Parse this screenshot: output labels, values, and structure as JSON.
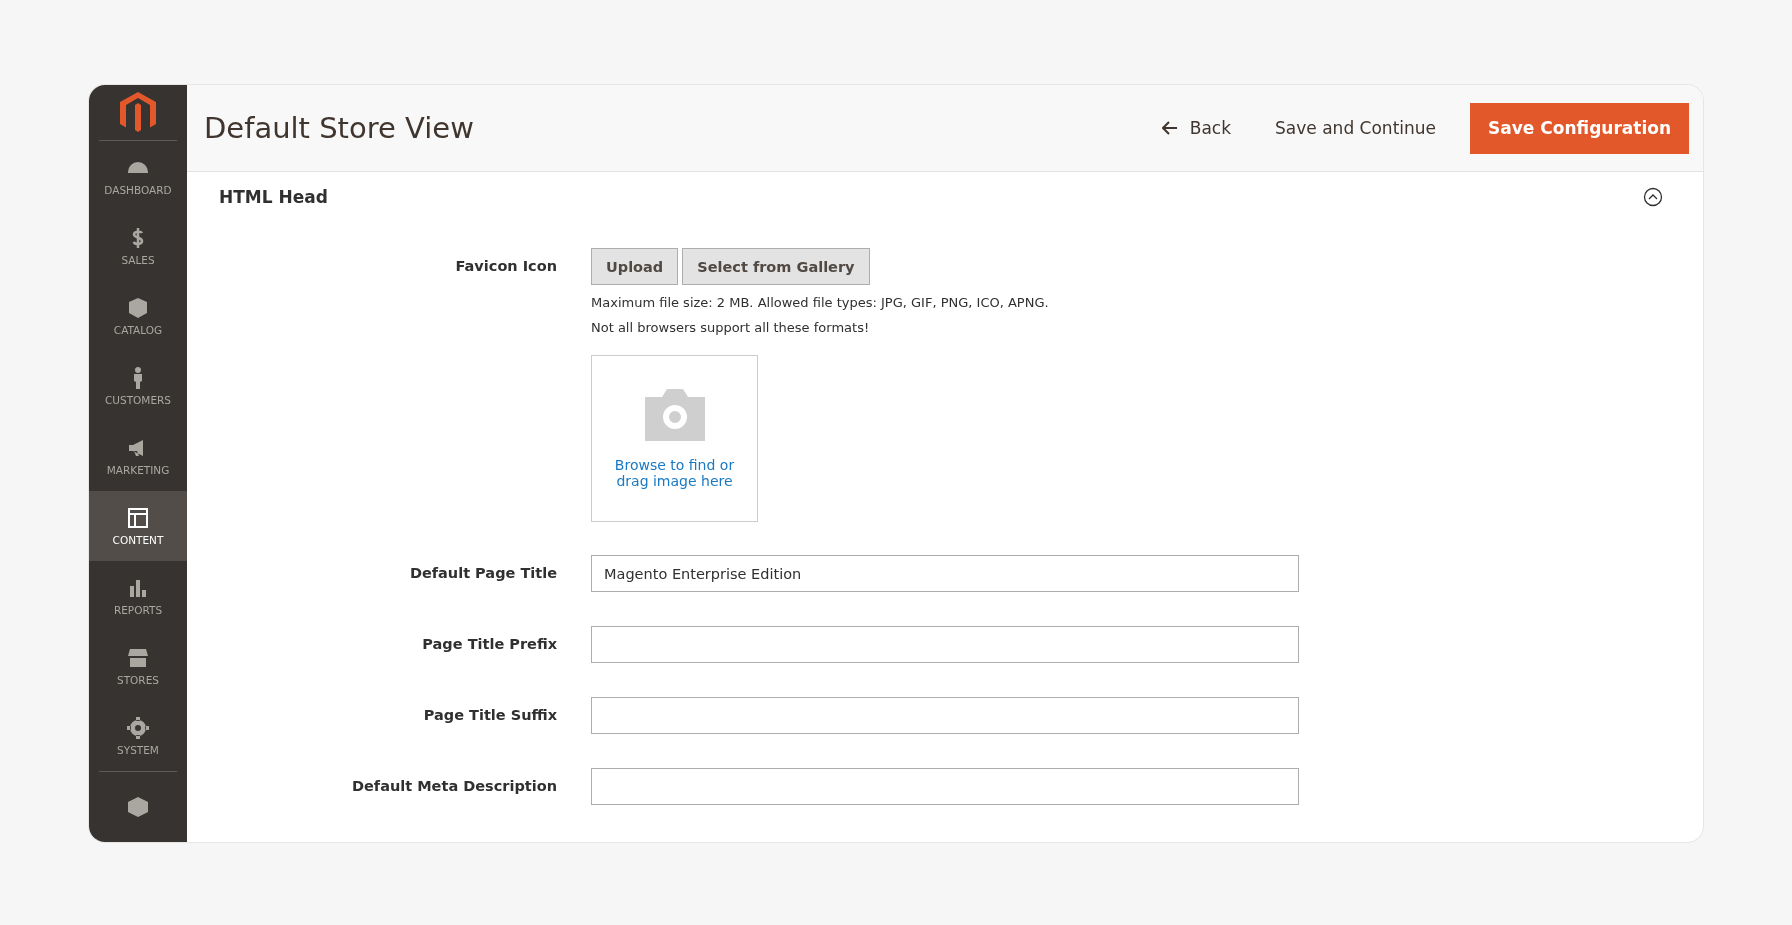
{
  "sidebar": {
    "items": [
      {
        "label": "DASHBOARD",
        "selected": false
      },
      {
        "label": "SALES",
        "selected": false
      },
      {
        "label": "CATALOG",
        "selected": false
      },
      {
        "label": "CUSTOMERS",
        "selected": false
      },
      {
        "label": "MARKETING",
        "selected": false
      },
      {
        "label": "CONTENT",
        "selected": true
      },
      {
        "label": "REPORTS",
        "selected": false
      },
      {
        "label": "STORES",
        "selected": false
      },
      {
        "label": "SYSTEM",
        "selected": false
      }
    ]
  },
  "header": {
    "title": "Default Store View",
    "back": "Back",
    "save_and_continue": "Save and Continue",
    "save_configuration": "Save Configuration"
  },
  "section": {
    "title": "HTML Head",
    "expanded": true,
    "fields": [
      {
        "kind": "image",
        "label": "Favicon Icon",
        "buttons": [
          "Upload",
          "Select from Gallery"
        ],
        "notes": [
          "Maximum file size: 2 MB. Allowed file types: JPG, GIF, PNG, ICO, APNG.",
          "Not all browsers support all these formats!"
        ],
        "dropzone": "Browse to find or drag image here"
      },
      {
        "kind": "text",
        "label": "Default Page Title",
        "value": "Magento Enterprise Edition"
      },
      {
        "kind": "text",
        "label": "Page Title Prefix"
      },
      {
        "kind": "text",
        "label": "Page Title Suffix"
      },
      {
        "kind": "text",
        "label": "Default Meta Description"
      }
    ]
  }
}
